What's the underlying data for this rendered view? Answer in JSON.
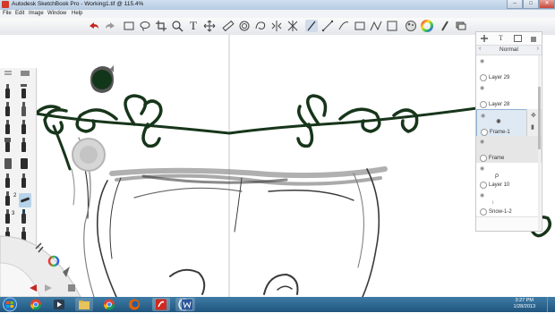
{
  "window": {
    "title": "Autodesk SketchBook Pro - Working1.tif @ 115.4%",
    "controls": {
      "minimize": "–",
      "maximize": "□",
      "close": "✕"
    }
  },
  "menu": [
    "File",
    "Edit",
    "Image",
    "Window",
    "Help"
  ],
  "toolbar": {
    "icons": [
      "undo-icon",
      "redo-icon",
      "new-canvas-icon",
      "lasso-select-icon",
      "crop-icon",
      "zoom-icon",
      "text-icon",
      "move-icon",
      "ruler-icon",
      "ellipse-guide-icon",
      "symmetry-icon",
      "perspective-icon",
      "distort-icon",
      "pen-stroke-icon",
      "line-icon",
      "straight-line-icon",
      "polyline-icon",
      "shape-icon",
      "color-wheel-icon",
      "brush-palette-icon",
      "copic-icon",
      "layer-editor-icon"
    ],
    "text_tool_glyph": "T"
  },
  "layer_panel": {
    "header_icons": [
      "add-layer-icon",
      "text-layer-icon",
      "image-layer-icon",
      "delete-layer-icon"
    ],
    "blend_mode": "Normal",
    "layers": [
      {
        "name": "Layer 29",
        "selected": false
      },
      {
        "name": "Layer 28",
        "selected": false
      },
      {
        "name": "Frame-1",
        "selected": true
      },
      {
        "name": "Frame",
        "selected": false
      },
      {
        "name": "Layer 10",
        "selected": false
      },
      {
        "name": "Snow-1-2",
        "selected": false
      }
    ]
  },
  "tool_palette": {
    "tool_numbers": [
      "2",
      "3"
    ]
  },
  "color_puck": {
    "color": "#12361a"
  },
  "stroke_color": "#17351a",
  "taskbar": {
    "clock_time": "3:27 PM",
    "clock_date": "1/28/2013",
    "apps": [
      "start-orb",
      "chrome",
      "media-player",
      "file-explorer",
      "google-chrome",
      "firefox",
      "app-circle",
      "sketchbook",
      "word"
    ]
  }
}
